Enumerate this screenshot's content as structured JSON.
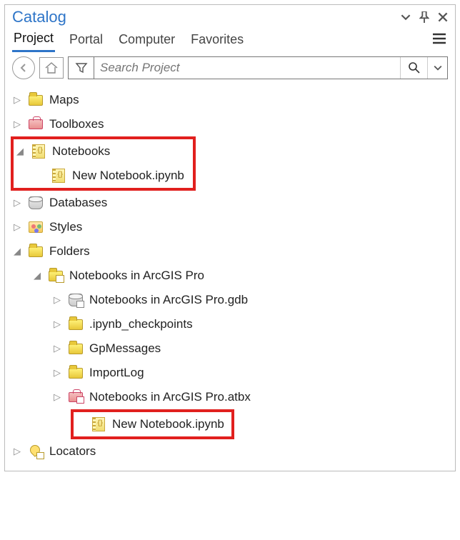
{
  "title": "Catalog",
  "tabs": [
    "Project",
    "Portal",
    "Computer",
    "Favorites"
  ],
  "activeTab": 0,
  "search": {
    "placeholder": "Search Project"
  },
  "tree": {
    "maps": "Maps",
    "toolboxes": "Toolboxes",
    "notebooks": "Notebooks",
    "newnb": "New Notebook.ipynb",
    "databases": "Databases",
    "styles": "Styles",
    "folders": "Folders",
    "proj": "Notebooks in ArcGIS Pro",
    "gdb": "Notebooks in ArcGIS Pro.gdb",
    "ckpt": ".ipynb_checkpoints",
    "gpmsg": "GpMessages",
    "implog": "ImportLog",
    "atbx": "Notebooks in ArcGIS Pro.atbx",
    "newnb2": "New Notebook.ipynb",
    "locators": "Locators"
  }
}
